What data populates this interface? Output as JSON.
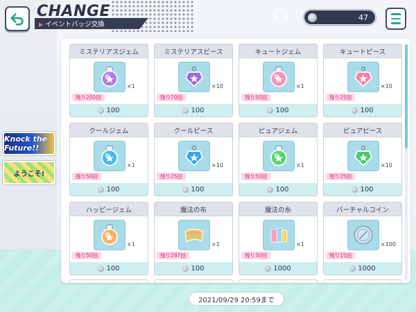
{
  "header": {
    "title": "CHANGE",
    "subtitle": "イベントバッジ交換",
    "badge_count": "47"
  },
  "banners": [
    {
      "label": "Knock the Future!!"
    },
    {
      "label": "ようこそ!"
    }
  ],
  "items": [
    {
      "name": "ミステリアスジェム",
      "qty": "×1",
      "remain": "残り200回",
      "price": "100",
      "icon": "mysterious-gem-bottle-icon",
      "color": "#b57ae6"
    },
    {
      "name": "ミステリアスピース",
      "qty": "×10",
      "remain": "残り70回",
      "price": "100",
      "icon": "mysterious-piece-icon",
      "color": "#9a6be0"
    },
    {
      "name": "キュートジェム",
      "qty": "×1",
      "remain": "残り50回",
      "price": "100",
      "icon": "cute-gem-bottle-icon",
      "color": "#ff8fb8"
    },
    {
      "name": "キュートピース",
      "qty": "×10",
      "remain": "残り25回",
      "price": "100",
      "icon": "cute-piece-icon",
      "color": "#ff7fa6"
    },
    {
      "name": "クールジェム",
      "qty": "×1",
      "remain": "残り50回",
      "price": "100",
      "icon": "cool-gem-bottle-icon",
      "color": "#4bb8f0"
    },
    {
      "name": "クールピース",
      "qty": "×10",
      "remain": "残り25回",
      "price": "100",
      "icon": "cool-piece-icon",
      "color": "#3aa6ea"
    },
    {
      "name": "ピュアジェム",
      "qty": "×1",
      "remain": "残り50回",
      "price": "100",
      "icon": "pure-gem-bottle-icon",
      "color": "#55d66f"
    },
    {
      "name": "ピュアピース",
      "qty": "×10",
      "remain": "残り25回",
      "price": "100",
      "icon": "pure-piece-icon",
      "color": "#49c865"
    },
    {
      "name": "ハッピージェム",
      "qty": "×1",
      "remain": "残り50回",
      "price": "100",
      "icon": "happy-gem-bottle-icon",
      "color": "#ffb25c"
    },
    {
      "name": "魔法の布",
      "qty": "×1",
      "remain": "残り287回",
      "price": "100",
      "icon": "magic-cloth-icon",
      "color": "#f4c04a"
    },
    {
      "name": "魔法の糸",
      "qty": "×1",
      "remain": "残り30回",
      "price": "1000",
      "icon": "magic-thread-icon",
      "color": "#7fd2e8"
    },
    {
      "name": "バーチャルコイン",
      "qty": "×100",
      "remain": "残り15回",
      "price": "1000",
      "icon": "virtual-coin-icon",
      "color": "#cfe9f4"
    }
  ],
  "footer": {
    "deadline": "2021/09/29 20:59まで"
  }
}
